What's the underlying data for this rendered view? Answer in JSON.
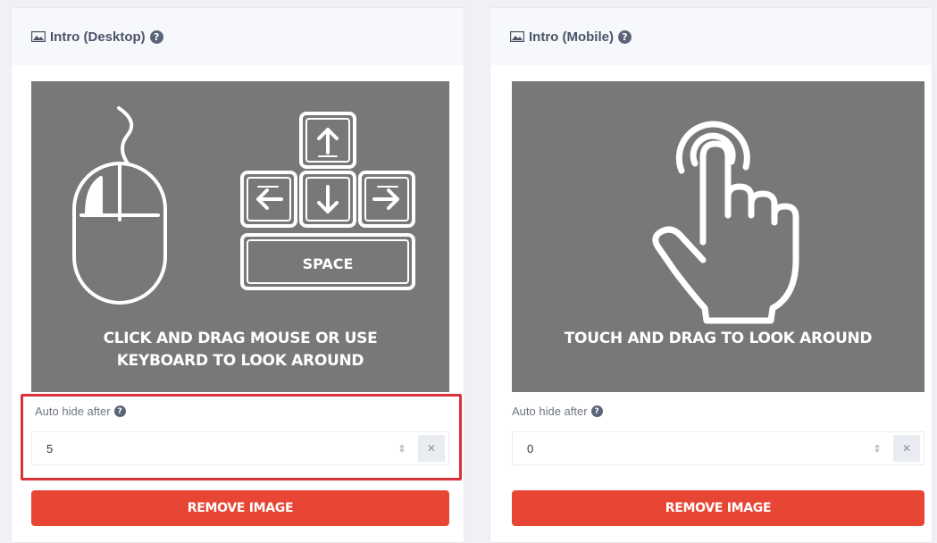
{
  "panels": {
    "desktop": {
      "title": "Intro (Desktop)",
      "help": "?",
      "caption_line1": "CLICK AND DRAG MOUSE OR USE",
      "caption_line2": "KEYBOARD TO LOOK AROUND",
      "space_key": "SPACE",
      "field_label": "Auto hide after",
      "field_value": "5",
      "remove_label": "REMOVE IMAGE"
    },
    "mobile": {
      "title": "Intro (Mobile)",
      "help": "?",
      "caption_line1": "TOUCH AND DRAG TO LOOK AROUND",
      "field_label": "Auto hide after",
      "field_value": "0",
      "remove_label": "REMOVE IMAGE"
    }
  },
  "icons": {
    "header": "image-icon",
    "help": "question-circle-icon",
    "spinner": "stepper-icon",
    "clear": "clear-icon"
  },
  "colors": {
    "remove_button": "#e84635",
    "preview_bg": "#787878",
    "highlight": "#d8323a"
  }
}
